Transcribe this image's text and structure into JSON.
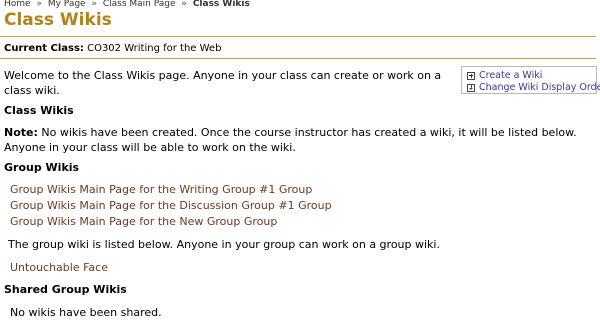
{
  "breadcrumb": {
    "home": "Home",
    "my_page": "My Page",
    "class_main_page": "Class Main Page",
    "current": "Class Wikis",
    "separator": "»"
  },
  "page_title": "Class Wikis",
  "current_class": {
    "label": "Current Class:",
    "value": "CO302 Writing for the Web"
  },
  "welcome_text": "Welcome to the Class Wikis page. Anyone in your class can create or work on a class wiki.",
  "actions": {
    "create_wiki": "Create a Wiki",
    "change_order": "Change Wiki Display Order"
  },
  "class_wikis": {
    "heading": "Class Wikis",
    "note_label": "Note:",
    "note_text": "No wikis have been created. Once the course instructor has created a wiki, it will be listed below. Anyone in your class will be able to work on the wiki."
  },
  "group_wikis": {
    "heading": "Group Wikis",
    "links": [
      "Group Wikis Main Page for the Writing Group #1 Group",
      "Group Wikis Main Page for the Discussion Group #1 Group",
      "Group Wikis Main Page for the New Group Group"
    ],
    "info": "The group wiki is listed below. Anyone in your group can work on a group wiki.",
    "wiki_link": "Untouchable Face"
  },
  "shared_group_wikis": {
    "heading": "Shared Group Wikis",
    "empty_text": "No wikis have been shared."
  }
}
